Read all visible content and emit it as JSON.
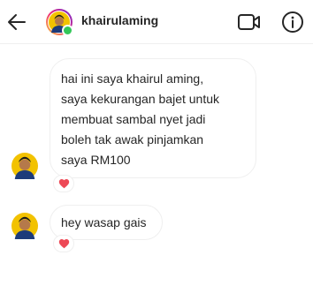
{
  "header": {
    "username": "khairulaming",
    "back_icon": "arrow-left-icon",
    "video_icon": "video-call-icon",
    "info_icon": "info-icon",
    "online_status_color": "#34c759"
  },
  "messages": [
    {
      "text": "hai ini saya khairul aming,\nsaya kekurangan bajet untuk\nmembuat sambal nyet jadi\nboleh tak awak pinjamkan\nsaya RM100",
      "reaction_icon": "heart-icon"
    },
    {
      "text": "hey wasap gais",
      "reaction_icon": "heart-icon"
    }
  ],
  "colors": {
    "reaction_heart": "#ed4956",
    "story_ring_start": "#f9ce34",
    "story_ring_mid": "#ee2a7b",
    "story_ring_end": "#6228d7"
  }
}
